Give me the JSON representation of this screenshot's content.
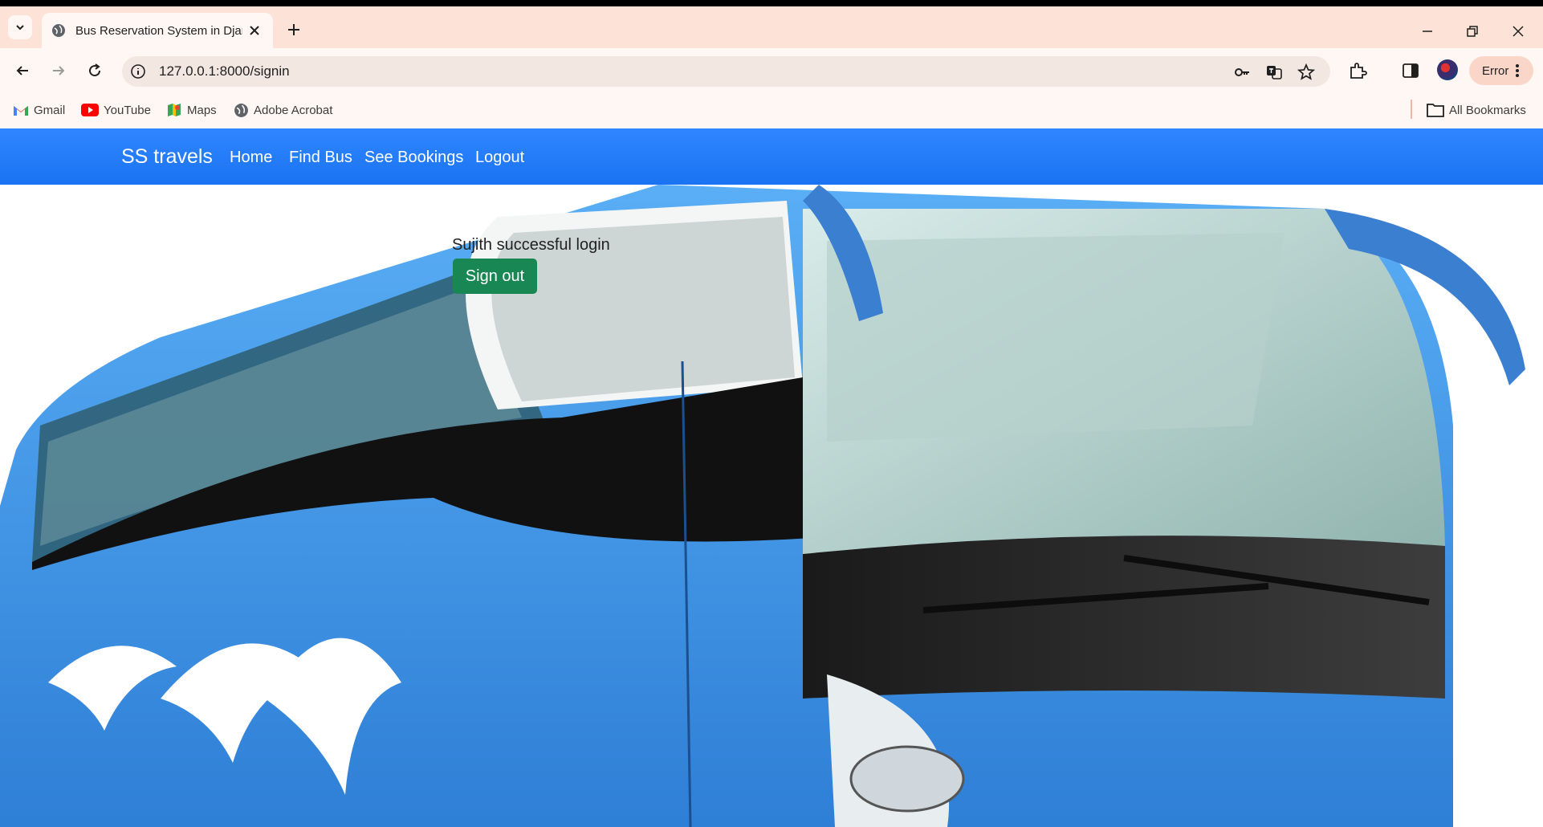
{
  "browser": {
    "tab_title": "Bus Reservation System in Djang",
    "url": "127.0.0.1:8000/signin",
    "profile_status": "Error"
  },
  "bookmarks": [
    {
      "label": "Gmail",
      "icon": "gmail-icon"
    },
    {
      "label": "YouTube",
      "icon": "youtube-icon"
    },
    {
      "label": "Maps",
      "icon": "maps-icon"
    },
    {
      "label": "Adobe Acrobat",
      "icon": "globe-icon"
    }
  ],
  "all_bookmarks_label": "All Bookmarks",
  "site": {
    "brand": "SS travels",
    "nav": [
      "Home",
      "Find Bus",
      "See Bookings",
      "Logout"
    ],
    "message": "Sujith successful login",
    "signout_label": "Sign out",
    "navbar_color": "#1a73f2",
    "button_color": "#198754"
  }
}
